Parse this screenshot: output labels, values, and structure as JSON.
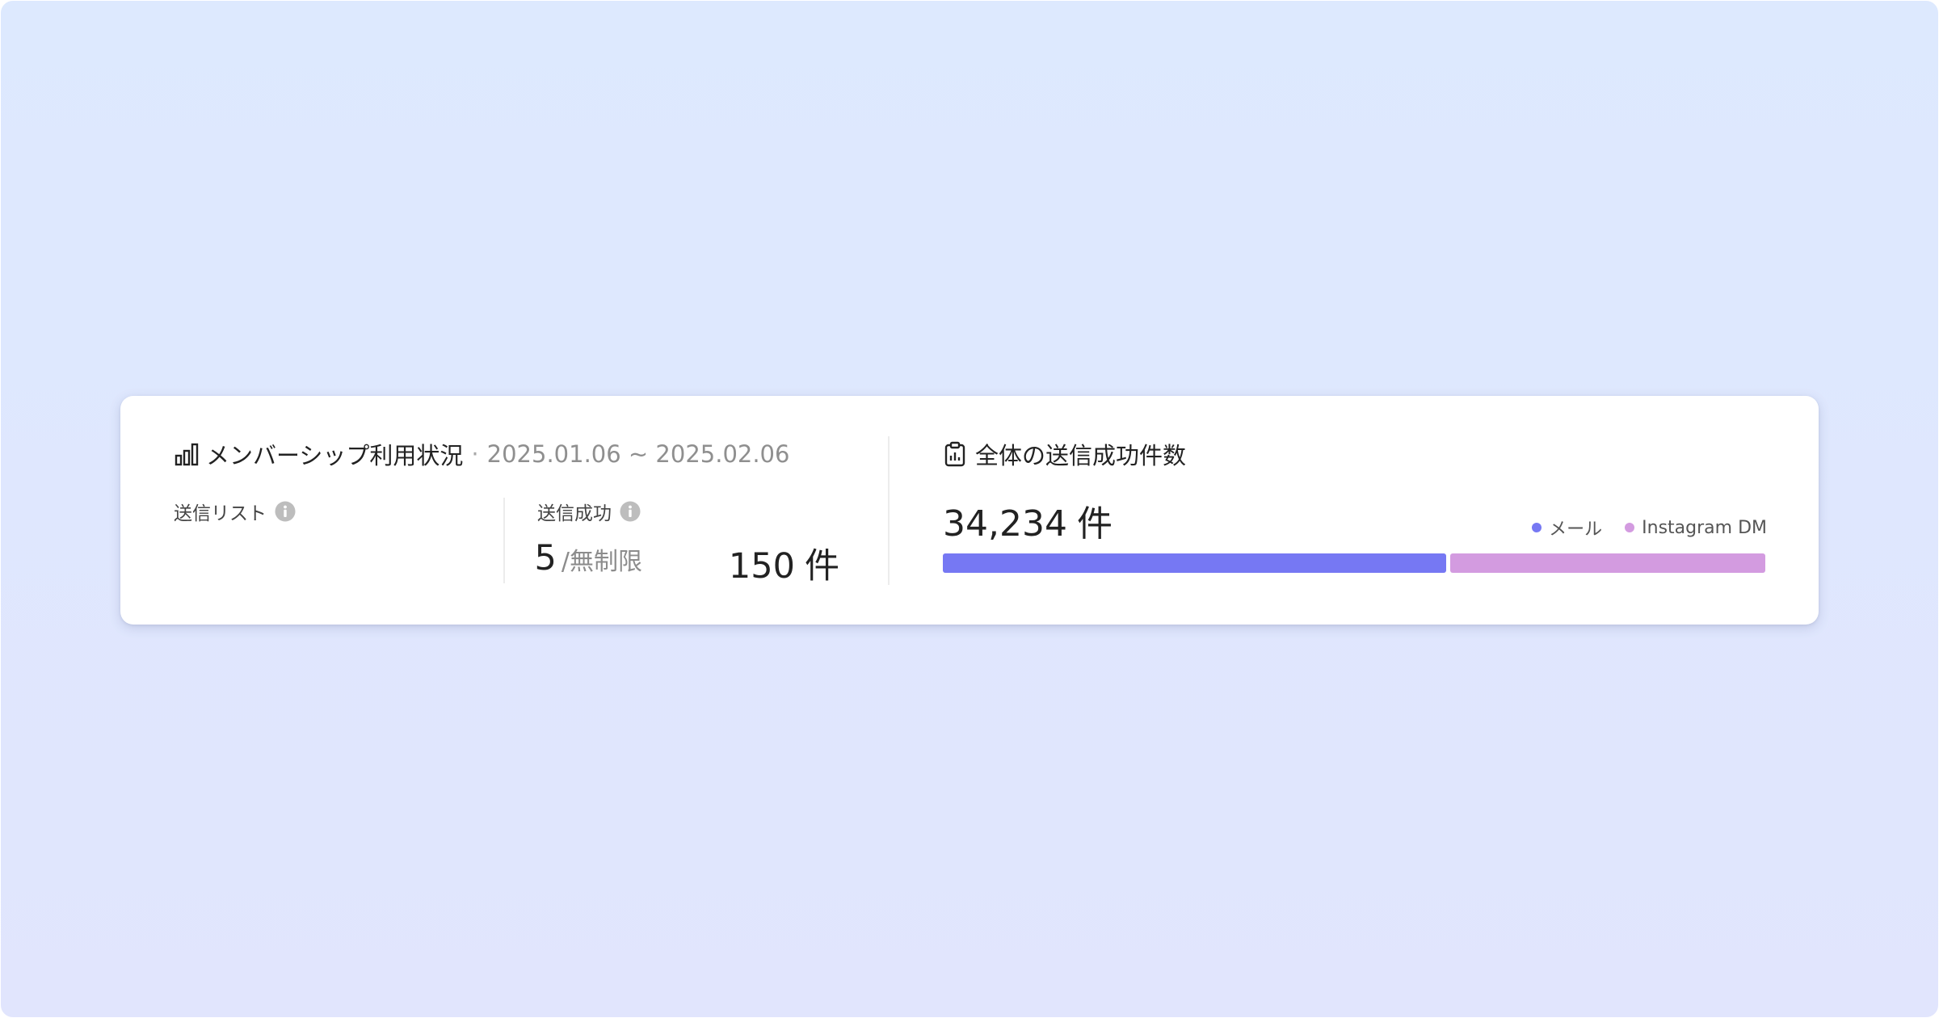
{
  "membership": {
    "title": "メンバーシップ利用状況",
    "separator": "·",
    "date_range": "2025.01.06 ~ 2025.02.06"
  },
  "stats": {
    "send_list": {
      "label": "送信リスト",
      "value": "5",
      "unit": "/無制限"
    },
    "send_success": {
      "label": "送信成功",
      "value": "150",
      "unit": "件"
    }
  },
  "total_success": {
    "title": "全体の送信成功件数",
    "value": "34,234",
    "unit": "件"
  },
  "chart_data": {
    "type": "bar",
    "orientation": "horizontal-stacked",
    "categories": [
      "メール",
      "Instagram DM"
    ],
    "values": [
      0.615,
      0.385
    ],
    "series": [
      {
        "name": "メール",
        "share": 0.615,
        "color": "#7678f3"
      },
      {
        "name": "Instagram DM",
        "share": 0.385,
        "color": "#d39be0"
      }
    ],
    "legend_position": "top-right"
  },
  "icons": {
    "header_icon": "bar-chart-icon",
    "info_icon": "info-icon",
    "total_icon": "clipboard-chart-icon"
  },
  "colors": {
    "mail": "#7678f3",
    "instagram": "#d39be0",
    "info_icon": "#bdbdbd"
  }
}
